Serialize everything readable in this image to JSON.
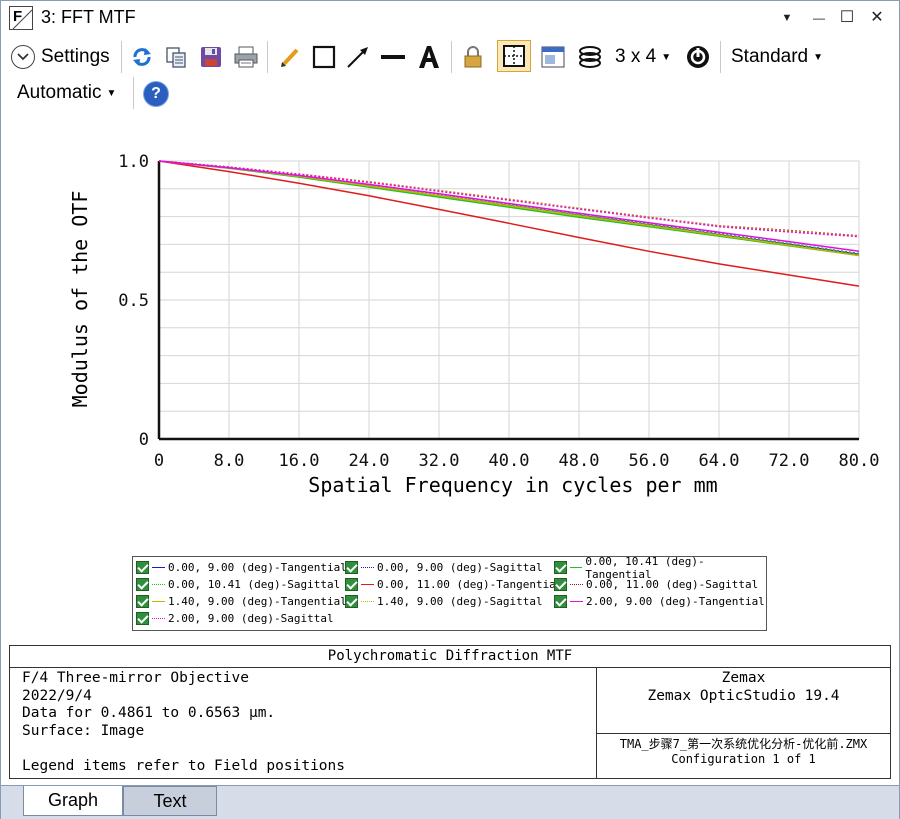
{
  "window": {
    "title": "3: FFT MTF",
    "app_icon_letter": "F",
    "controls": {
      "dropdown": "▼",
      "minimize": "—",
      "maximize": "☐",
      "close": "✕"
    }
  },
  "toolbar": {
    "settings_label": "Settings",
    "settings_icon": "chevron-down-icon",
    "layout_label": "3 x 4",
    "standard_label": "Standard",
    "automatic_label": "Automatic",
    "help_glyph": "?",
    "icons": [
      "refresh-icon",
      "copy-icon",
      "save-icon",
      "print-icon",
      "pencil-icon",
      "rectangle-icon",
      "arrow-icon",
      "line-icon",
      "text-icon",
      "lock-icon",
      "grid-icon",
      "window-icon",
      "layers-icon",
      "rotate-icon",
      "help-icon"
    ]
  },
  "chart_data": {
    "type": "line",
    "title": "",
    "xlabel": "Spatial Frequency in cycles per mm",
    "ylabel": "Modulus of the OTF",
    "xlim": [
      0,
      80
    ],
    "ylim": [
      0,
      1
    ],
    "x_ticks": [
      "0",
      "8.0",
      "16.0",
      "24.0",
      "32.0",
      "40.0",
      "48.0",
      "56.0",
      "64.0",
      "72.0",
      "80.0"
    ],
    "y_ticks": [
      "0",
      "0.5",
      "1.0"
    ],
    "grid": true,
    "x": [
      0,
      8,
      16,
      24,
      32,
      40,
      48,
      56,
      64,
      72,
      80
    ],
    "series": [
      {
        "name": "0.00, 9.00 (deg)-Tangential",
        "color": "#1a1ad6",
        "dash": "solid",
        "values": [
          1.0,
          0.975,
          0.945,
          0.91,
          0.875,
          0.84,
          0.805,
          0.77,
          0.735,
          0.7,
          0.664
        ]
      },
      {
        "name": "0.00, 9.00 (deg)-Sagittal",
        "color": "#1a1ad6",
        "dash": "dotted",
        "values": [
          1.0,
          0.975,
          0.946,
          0.912,
          0.878,
          0.843,
          0.808,
          0.773,
          0.738,
          0.703,
          0.667
        ]
      },
      {
        "name": "0.00, 10.41 (deg)-Tangential",
        "color": "#22c322",
        "dash": "solid",
        "values": [
          1.0,
          0.974,
          0.942,
          0.906,
          0.87,
          0.834,
          0.798,
          0.764,
          0.73,
          0.695,
          0.66
        ]
      },
      {
        "name": "0.00, 10.41 (deg)-Sagittal",
        "color": "#22c322",
        "dash": "dotted",
        "values": [
          1.0,
          0.975,
          0.946,
          0.912,
          0.877,
          0.842,
          0.807,
          0.772,
          0.737,
          0.702,
          0.666
        ]
      },
      {
        "name": "0.00, 11.00 (deg)-Tangential",
        "color": "#e01b1b",
        "dash": "solid",
        "values": [
          1.0,
          0.962,
          0.92,
          0.875,
          0.826,
          0.776,
          0.725,
          0.675,
          0.63,
          0.59,
          0.55
        ]
      },
      {
        "name": "0.00, 11.00 (deg)-Sagittal",
        "color": "#a01010",
        "dash": "dotted",
        "values": [
          1.0,
          0.978,
          0.953,
          0.925,
          0.894,
          0.862,
          0.83,
          0.798,
          0.767,
          0.75,
          0.731
        ]
      },
      {
        "name": "1.40, 9.00 (deg)-Tangential",
        "color": "#c8b400",
        "dash": "solid",
        "values": [
          1.0,
          0.975,
          0.945,
          0.91,
          0.875,
          0.839,
          0.803,
          0.768,
          0.733,
          0.697,
          0.66
        ]
      },
      {
        "name": "1.40, 9.00 (deg)-Sagittal",
        "color": "#c8b400",
        "dash": "dotted",
        "values": [
          1.0,
          0.978,
          0.953,
          0.925,
          0.893,
          0.861,
          0.829,
          0.797,
          0.766,
          0.748,
          0.73
        ]
      },
      {
        "name": "2.00, 9.00 (deg)-Tangential",
        "color": "#e010e0",
        "dash": "solid",
        "values": [
          1.0,
          0.976,
          0.948,
          0.916,
          0.882,
          0.847,
          0.812,
          0.778,
          0.744,
          0.71,
          0.675
        ]
      },
      {
        "name": "2.00, 9.00 (deg)-Sagittal",
        "color": "#e010e0",
        "dash": "dotted",
        "values": [
          1.0,
          0.978,
          0.952,
          0.923,
          0.891,
          0.859,
          0.827,
          0.795,
          0.764,
          0.745,
          0.728
        ]
      }
    ]
  },
  "info": {
    "header": "Polychromatic Diffraction MTF",
    "title": "F/4 Three-mirror Objective",
    "date": "2022/9/4",
    "data_range": "Data for 0.4861 to 0.6563 µm.",
    "surface": "Surface: Image",
    "legend_note": "Legend items refer to Field positions",
    "vendor": "Zemax",
    "product": "Zemax OpticStudio 19.4",
    "file": "TMA_步骤7_第一次系统优化分析-优化前.ZMX",
    "configuration": "Configuration 1 of 1"
  },
  "tabs": [
    {
      "label": "Graph",
      "active": true
    },
    {
      "label": "Text",
      "active": false
    }
  ]
}
